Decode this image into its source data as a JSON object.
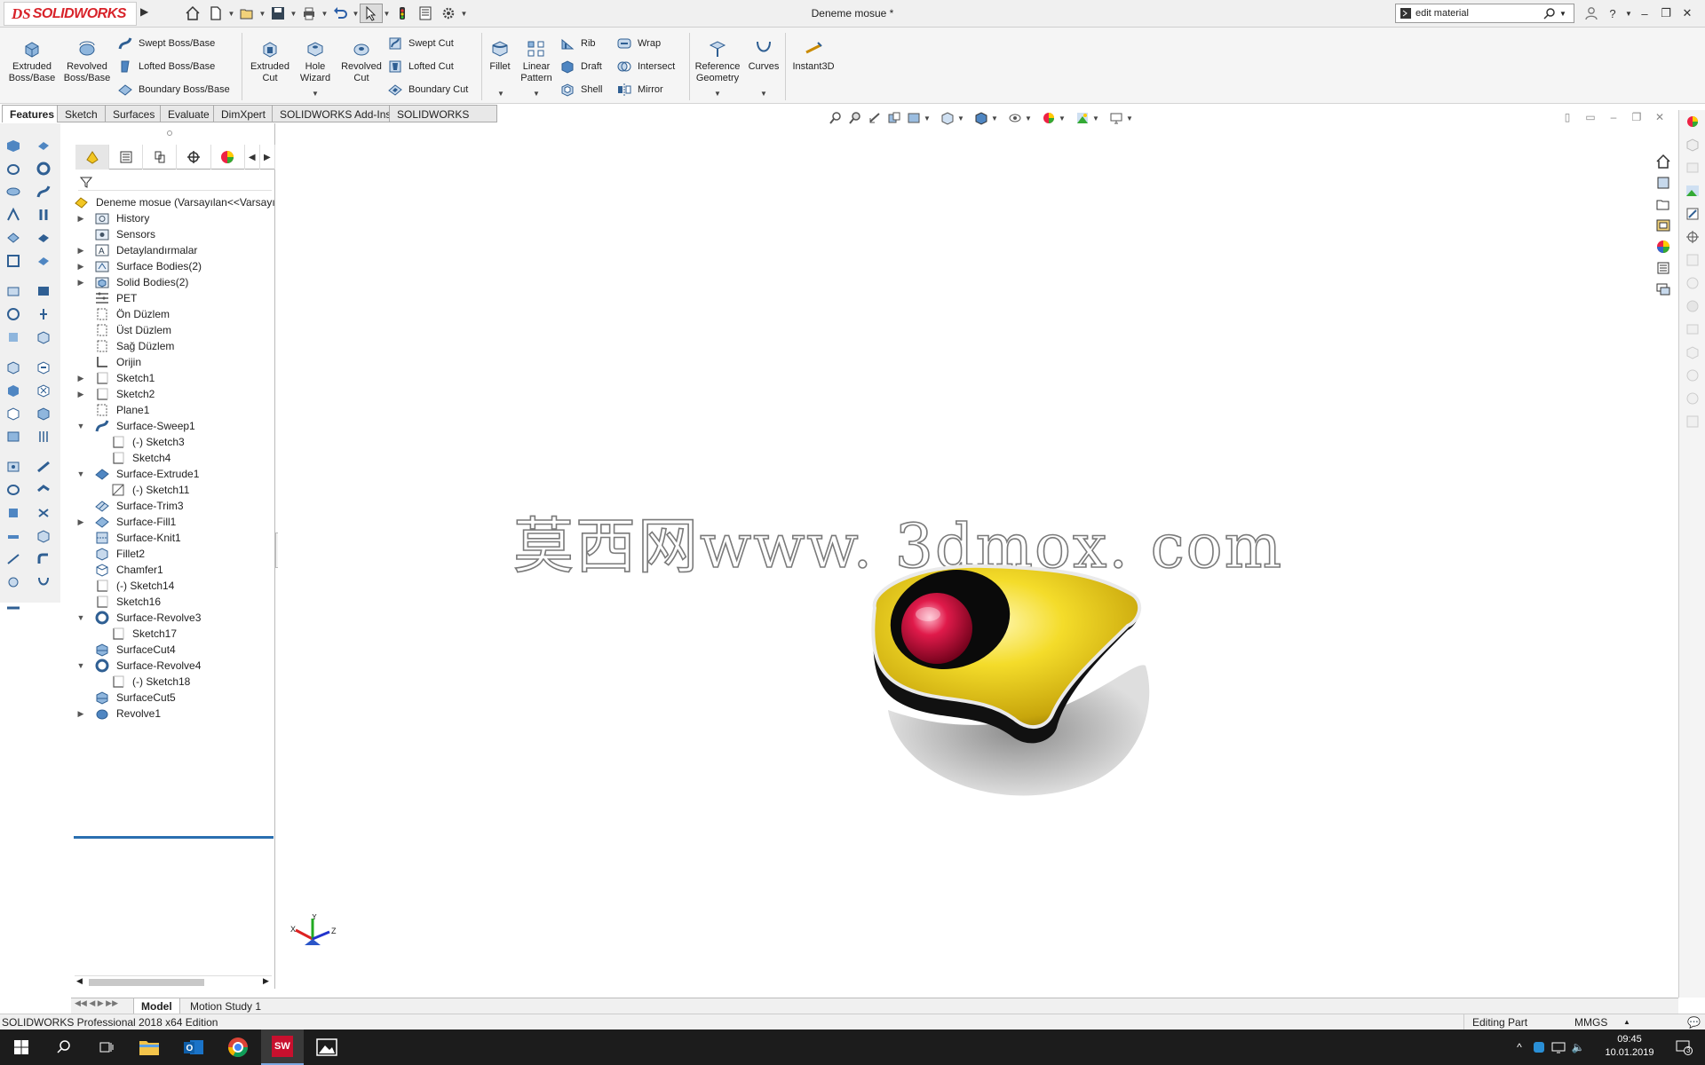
{
  "app": {
    "logo_prefix": "DS",
    "logo_text": "SOLIDWORKS",
    "document_title": "Deneme mosue *",
    "search_value": "edit material"
  },
  "command_manager": {
    "extruded_boss": "Extruded\nBoss/Base",
    "revolved_boss": "Revolved\nBoss/Base",
    "swept_boss": "Swept Boss/Base",
    "lofted_boss": "Lofted Boss/Base",
    "boundary_boss": "Boundary Boss/Base",
    "extruded_cut": "Extruded\nCut",
    "hole_wizard": "Hole\nWizard",
    "revolved_cut": "Revolved\nCut",
    "swept_cut": "Swept Cut",
    "lofted_cut": "Lofted Cut",
    "boundary_cut": "Boundary Cut",
    "fillet": "Fillet",
    "linear_pattern": "Linear\nPattern",
    "rib": "Rib",
    "draft": "Draft",
    "shell": "Shell",
    "wrap": "Wrap",
    "intersect": "Intersect",
    "mirror": "Mirror",
    "reference_geometry": "Reference\nGeometry",
    "curves": "Curves",
    "instant3d": "Instant3D"
  },
  "tabs": [
    "Features",
    "Sketch",
    "Surfaces",
    "Evaluate",
    "DimXpert",
    "SOLIDWORKS Add-Ins",
    "SOLIDWORKS CAM"
  ],
  "feature_tree": {
    "root": "Deneme mosue  (Varsayılan<<Varsayı",
    "nodes": [
      {
        "label": "History",
        "icon": "history-folder-icon",
        "indent": 0,
        "toggle": "collapsed"
      },
      {
        "label": "Sensors",
        "icon": "sensors-icon",
        "indent": 0,
        "toggle": "none"
      },
      {
        "label": "Detaylandırmalar",
        "icon": "annotations-icon",
        "indent": 0,
        "toggle": "collapsed"
      },
      {
        "label": "Surface Bodies(2)",
        "icon": "surface-bodies-icon",
        "indent": 0,
        "toggle": "collapsed"
      },
      {
        "label": "Solid Bodies(2)",
        "icon": "solid-bodies-icon",
        "indent": 0,
        "toggle": "collapsed"
      },
      {
        "label": "PET",
        "icon": "material-icon",
        "indent": 0,
        "toggle": "none"
      },
      {
        "label": "Ön Düzlem",
        "icon": "plane-icon",
        "indent": 0,
        "toggle": "none"
      },
      {
        "label": "Üst Düzlem",
        "icon": "plane-icon",
        "indent": 0,
        "toggle": "none"
      },
      {
        "label": "Sağ Düzlem",
        "icon": "plane-icon",
        "indent": 0,
        "toggle": "none"
      },
      {
        "label": "Orijin",
        "icon": "origin-icon",
        "indent": 0,
        "toggle": "none"
      },
      {
        "label": "Sketch1",
        "icon": "sketch-icon",
        "indent": 0,
        "toggle": "collapsed"
      },
      {
        "label": "Sketch2",
        "icon": "sketch-icon",
        "indent": 0,
        "toggle": "collapsed"
      },
      {
        "label": "Plane1",
        "icon": "plane-icon",
        "indent": 0,
        "toggle": "none"
      },
      {
        "label": "Surface-Sweep1",
        "icon": "surface-sweep-icon",
        "indent": 0,
        "toggle": "expanded"
      },
      {
        "label": "(-) Sketch3",
        "icon": "sketch-icon",
        "indent": 1,
        "toggle": "none"
      },
      {
        "label": "Sketch4",
        "icon": "sketch-icon",
        "indent": 1,
        "toggle": "none"
      },
      {
        "label": "Surface-Extrude1",
        "icon": "surface-extrude-icon",
        "indent": 0,
        "toggle": "expanded"
      },
      {
        "label": "(-) Sketch11",
        "icon": "sketch-3d-icon",
        "indent": 1,
        "toggle": "none"
      },
      {
        "label": "Surface-Trim3",
        "icon": "surface-trim-icon",
        "indent": 0,
        "toggle": "none"
      },
      {
        "label": "Surface-Fill1",
        "icon": "surface-fill-icon",
        "indent": 0,
        "toggle": "collapsed"
      },
      {
        "label": "Surface-Knit1",
        "icon": "surface-knit-icon",
        "indent": 0,
        "toggle": "none"
      },
      {
        "label": "Fillet2",
        "icon": "fillet-icon",
        "indent": 0,
        "toggle": "none"
      },
      {
        "label": "Chamfer1",
        "icon": "chamfer-icon",
        "indent": 0,
        "toggle": "none"
      },
      {
        "label": "(-) Sketch14",
        "icon": "sketch-icon",
        "indent": 0,
        "toggle": "none"
      },
      {
        "label": "Sketch16",
        "icon": "sketch-icon",
        "indent": 0,
        "toggle": "none"
      },
      {
        "label": "Surface-Revolve3",
        "icon": "surface-revolve-icon",
        "indent": 0,
        "toggle": "expanded"
      },
      {
        "label": "Sketch17",
        "icon": "sketch-icon",
        "indent": 1,
        "toggle": "none"
      },
      {
        "label": "SurfaceCut4",
        "icon": "surface-cut-icon",
        "indent": 0,
        "toggle": "none"
      },
      {
        "label": "Surface-Revolve4",
        "icon": "surface-revolve-icon",
        "indent": 0,
        "toggle": "expanded"
      },
      {
        "label": "(-) Sketch18",
        "icon": "sketch-icon",
        "indent": 1,
        "toggle": "none"
      },
      {
        "label": "SurfaceCut5",
        "icon": "surface-cut-icon",
        "indent": 0,
        "toggle": "none"
      },
      {
        "label": "Revolve1",
        "icon": "revolve-icon",
        "indent": 0,
        "toggle": "collapsed"
      }
    ]
  },
  "graphics": {
    "watermark": "莫西网www. 3dmox. com",
    "triad_x": "X",
    "triad_y": "Y",
    "triad_z": "Z"
  },
  "bottom_tabs": [
    "Model",
    "Motion Study 1"
  ],
  "status": {
    "edition": "SOLIDWORKS Professional 2018 x64 Edition",
    "mode": "Editing Part",
    "units": "MMGS"
  },
  "taskbar": {
    "time": "09:45",
    "date": "10.01.2019",
    "notifications": "3"
  },
  "colors": {
    "accent": "#d8232a",
    "rollback_bar": "#2a6fb0",
    "model_yellow": "#f0d21a",
    "ball_red": "#d8163e"
  }
}
